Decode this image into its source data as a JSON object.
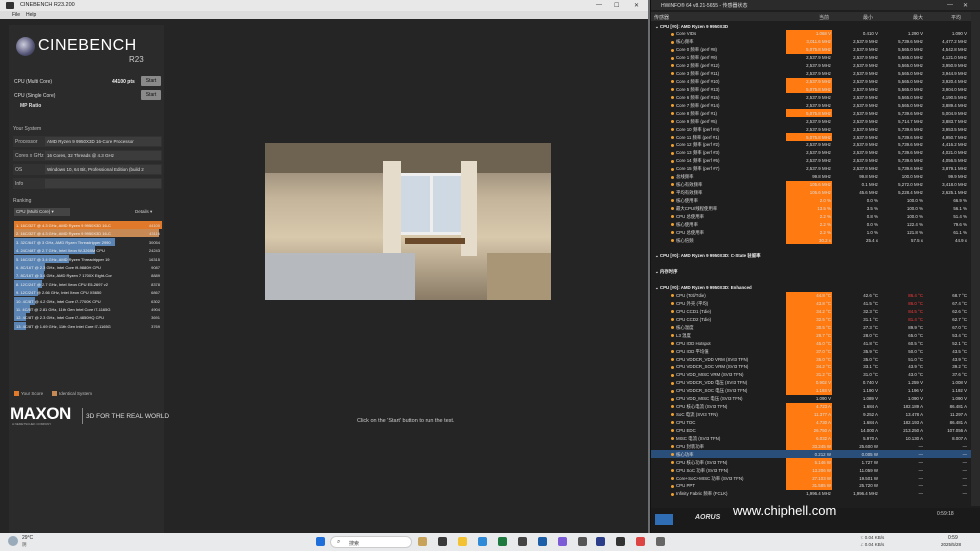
{
  "cinebench": {
    "title": "CINEBENCH R23.200",
    "menu": [
      "File",
      "Help"
    ],
    "logo": "CINEBENCH",
    "logo_sub": "R23",
    "tests": [
      {
        "label": "CPU (Multi Core)",
        "value": "44100 pts",
        "button": "Start"
      },
      {
        "label": "CPU (Single Core)",
        "value": "",
        "button": "Start"
      },
      {
        "label": "MP Ratio",
        "value": "",
        "button": ""
      }
    ],
    "system_heading": "Your System",
    "system": [
      {
        "key": "Processor",
        "value": "AMD Ryzen 9 9950X3D 16-Core Processor"
      },
      {
        "key": "Cores x GHz",
        "value": "16 Cores, 32 Threads @ 4.3 GHz"
      },
      {
        "key": "OS",
        "value": "Windows 10, 64 Bit, Professional Edition (build 2"
      },
      {
        "key": "Info",
        "value": ""
      }
    ],
    "ranking_heading": "Ranking",
    "ranking_dropdown": "CPU (Multi Core)",
    "details_label": "Details",
    "ranking": [
      {
        "label": "1. 16C/32T @ 4.3 GHz, AMD Ryzen 9 9950X3D 16-C",
        "score": "44100",
        "pct": 1.0,
        "color": "#e07a2a"
      },
      {
        "label": "2. 16C/32T @ 4.3 GHz, AMD Ryzen 9 9950X3D 16-C",
        "score": "43116",
        "pct": 0.98,
        "color": "#c88a55"
      },
      {
        "label": "3. 32C/64T @ 3 GHz, AMD Ryzen Threadripper 2990",
        "score": "30054",
        "pct": 0.68,
        "color": "#5a84b4"
      },
      {
        "label": "4. 24C/48T @ 2.7 GHz, Intel Xeon W-3265M CPU",
        "score": "24243",
        "pct": 0.55,
        "color": "#5a84b4"
      },
      {
        "label": "5. 16C/32T @ 3.4 GHz, AMD Ryzen Threadripper 19",
        "score": "16315",
        "pct": 0.37,
        "color": "#5a84b4"
      },
      {
        "label": "6. 8C/16T @ 2.3 GHz, Intel Core i9-9880H CPU",
        "score": "9087",
        "pct": 0.21,
        "color": "#5a84b4"
      },
      {
        "label": "7. 8C/16T @ 3.4 GHz, AMD Ryzen 7 1700X Eight-Cor",
        "score": "8889",
        "pct": 0.2,
        "color": "#5a84b4"
      },
      {
        "label": "8. 12C/24T @ 2.7 GHz, Intel Xeon CPU E5-2697 v2",
        "score": "8378",
        "pct": 0.19,
        "color": "#5a84b4"
      },
      {
        "label": "9. 12C/24T @ 2.66 GHz, Intel Xeon CPU X5650",
        "score": "6867",
        "pct": 0.16,
        "color": "#5a84b4"
      },
      {
        "label": "10. 4C/8T @ 4.2 GHz, Intel Core i7-7700K CPU",
        "score": "6302",
        "pct": 0.14,
        "color": "#5a84b4"
      },
      {
        "label": "11. 4C/8T @ 2.81 GHz, 11th Gen Intel Core i7-1165G",
        "score": "4904",
        "pct": 0.11,
        "color": "#5a84b4"
      },
      {
        "label": "12. 4C/8T @ 2.3 GHz, Intel Core i7-4850HQ CPU",
        "score": "3691",
        "pct": 0.08,
        "color": "#5a84b4"
      },
      {
        "label": "13. 4C/8T @ 1.69 GHz, 11th Gen Intel Core i7-1165G",
        "score": "3769",
        "pct": 0.08,
        "color": "#5a84b4"
      }
    ],
    "legend_your": "Your Score",
    "legend_identical": "Identical System",
    "brand": "MAXON",
    "brand_sub": "A NEMETSCHEK COMPANY",
    "tagline": "3D FOR THE REAL WORLD",
    "status_message": "Click on the 'Start' button to run the test."
  },
  "hwinfo": {
    "title": "HWiNFO® 64 v8.21-5655 - 传感器状态",
    "columns": [
      "传感器",
      "当前",
      "最小",
      "最大",
      "平均"
    ],
    "rows": [
      {
        "name": "CPU [#0]: AMD Ryzen 9 9950X3D",
        "group": true
      },
      {
        "name": "Core VIDs",
        "cur": "1.068 V",
        "min": "0.410 V",
        "max": "1.290 V",
        "avg": "1.090 V",
        "hl": true
      },
      {
        "name": "核心频率",
        "cur": "3,011.6 MHz",
        "min": "2,537.9 MHz",
        "max": "5,739.6 MHz",
        "avg": "4,477.2 MHz",
        "hl": true
      },
      {
        "name": "Core 0 频率 (perf #8)",
        "cur": "5,075.8 MHz",
        "min": "2,537.9 MHz",
        "max": "5,565.0 MHz",
        "avg": "4,542.8 MHz",
        "hl": true
      },
      {
        "name": "Core 1 频率 (perf #9)",
        "cur": "2,537.9 MHz",
        "min": "2,537.9 MHz",
        "max": "5,565.0 MHz",
        "avg": "4,121.0 MHz"
      },
      {
        "name": "Core 2 频率 (perf #12)",
        "cur": "2,537.9 MHz",
        "min": "2,537.9 MHz",
        "max": "5,565.0 MHz",
        "avg": "3,950.9 MHz"
      },
      {
        "name": "Core 3 频率 (perf #11)",
        "cur": "2,537.9 MHz",
        "min": "2,537.9 MHz",
        "max": "5,565.0 MHz",
        "avg": "3,944.9 MHz"
      },
      {
        "name": "Core 4 频率 (perf #10)",
        "cur": "2,537.9 MHz",
        "min": "2,537.9 MHz",
        "max": "5,565.0 MHz",
        "avg": "3,920.4 MHz",
        "hl": true
      },
      {
        "name": "Core 5 频率 (perf #13)",
        "cur": "5,075.8 MHz",
        "min": "2,537.9 MHz",
        "max": "5,565.0 MHz",
        "avg": "3,904.0 MHz",
        "hl": true
      },
      {
        "name": "Core 6 频率 (perf #15)",
        "cur": "2,537.9 MHz",
        "min": "2,537.9 MHz",
        "max": "5,565.0 MHz",
        "avg": "4,190.5 MHz"
      },
      {
        "name": "Core 7 频率 (perf #14)",
        "cur": "2,537.9 MHz",
        "min": "2,537.9 MHz",
        "max": "5,565.0 MHz",
        "avg": "3,889.4 MHz"
      },
      {
        "name": "Core 8 频率 (perf #1)",
        "cur": "5,075.8 MHz",
        "min": "2,537.9 MHz",
        "max": "5,739.6 MHz",
        "avg": "5,004.9 MHz",
        "hl": true
      },
      {
        "name": "Core 9 频率 (perf #5)",
        "cur": "2,537.9 MHz",
        "min": "2,537.9 MHz",
        "max": "5,714.7 MHz",
        "avg": "3,883.7 MHz"
      },
      {
        "name": "Core 10 频率 (perf #4)",
        "cur": "2,537.9 MHz",
        "min": "2,537.9 MHz",
        "max": "5,739.6 MHz",
        "avg": "3,953.5 MHz"
      },
      {
        "name": "Core 11 频率 (perf #1)",
        "cur": "5,075.8 MHz",
        "min": "2,537.9 MHz",
        "max": "5,739.6 MHz",
        "avg": "4,950.7 MHz",
        "hl": true
      },
      {
        "name": "Core 12 频率 (perf #2)",
        "cur": "2,537.9 MHz",
        "min": "2,537.9 MHz",
        "max": "5,739.6 MHz",
        "avg": "4,416.2 MHz"
      },
      {
        "name": "Core 13 频率 (perf #3)",
        "cur": "2,537.9 MHz",
        "min": "2,537.9 MHz",
        "max": "5,739.6 MHz",
        "avg": "4,021.0 MHz"
      },
      {
        "name": "Core 14 频率 (perf #6)",
        "cur": "2,537.9 MHz",
        "min": "2,537.9 MHz",
        "max": "5,739.6 MHz",
        "avg": "4,056.5 MHz"
      },
      {
        "name": "Core 15 频率 (perf #7)",
        "cur": "2,537.9 MHz",
        "min": "2,537.9 MHz",
        "max": "5,739.6 MHz",
        "avg": "3,879.1 MHz"
      },
      {
        "name": "总线频率",
        "cur": "99.8 MHz",
        "min": "99.8 MHz",
        "max": "100.0 MHz",
        "avg": "99.9 MHz"
      },
      {
        "name": "核心有效频率",
        "cur": "105.6 MHz",
        "min": "0.1 MHz",
        "max": "5,272.0 MHz",
        "avg": "3,418.0 MHz",
        "hl": true
      },
      {
        "name": "平均有效频率",
        "cur": "105.6 MHz",
        "min": "45.6 MHz",
        "max": "5,228.4 MHz",
        "avg": "2,625.1 MHz",
        "hl": true
      },
      {
        "name": "核心使用率",
        "cur": "2.0 %",
        "min": "0.0 %",
        "max": "100.0 %",
        "avg": "66.9 %",
        "hl": true
      },
      {
        "name": "最大CPU/线程使用率",
        "cur": "13.5 %",
        "min": "3.5 %",
        "max": "100.0 %",
        "avg": "56.1 %",
        "hl": true
      },
      {
        "name": "CPU 总使用率",
        "cur": "2.2 %",
        "min": "0.8 %",
        "max": "100.0 %",
        "avg": "51.4 %",
        "hl": true
      },
      {
        "name": "核心使用率",
        "cur": "2.2 %",
        "min": "0.0 %",
        "max": "122.4 %",
        "avg": "79.6 %",
        "hl": true
      },
      {
        "name": "CPU 总使用率",
        "cur": "2.2 %",
        "min": "1.0 %",
        "max": "121.8 %",
        "avg": "61.1 %",
        "hl": true
      },
      {
        "name": "核心倍频",
        "cur": "30.2 x",
        "min": "25.4 x",
        "max": "57.5 x",
        "avg": "44.9 x",
        "hl": true
      },
      {
        "name": "",
        "spacer": true
      },
      {
        "name": "CPU [#0]: AMD Ryzen 9 9950X3D: C-State 驻留率",
        "group": true
      },
      {
        "name": "",
        "spacer": true
      },
      {
        "name": "内存时序",
        "group": true
      },
      {
        "name": "",
        "spacer": true
      },
      {
        "name": "CPU [#0]: AMD Ryzen 9 9950X3D: Enhanced",
        "group": true
      },
      {
        "name": "CPU (Tctl/Tdie)",
        "cur": "44.8 °C",
        "min": "42.6 °C",
        "max": "86.4 °C",
        "avg": "68.7 °C",
        "hl": true,
        "redmax": true
      },
      {
        "name": "CPU 外壳 (平均)",
        "cur": "43.8 °C",
        "min": "41.5 °C",
        "max": "86.0 °C",
        "avg": "67.4 °C",
        "hl": true,
        "redmax": true
      },
      {
        "name": "CPU CCD1 (Tdie)",
        "cur": "34.2 °C",
        "min": "32.3 °C",
        "max": "84.5 °C",
        "avg": "62.6 °C",
        "hl": true,
        "redmax": true
      },
      {
        "name": "CPU CCD2 (Tdie)",
        "cur": "32.5 °C",
        "min": "31.1 °C",
        "max": "81.4 °C",
        "avg": "62.7 °C",
        "hl": true,
        "redmax": true
      },
      {
        "name": "核心温度",
        "cur": "30.5 °C",
        "min": "27.3 °C",
        "max": "89.9 °C",
        "avg": "67.0 °C",
        "hl": true
      },
      {
        "name": "L3 温度",
        "cur": "29.7 °C",
        "min": "28.0 °C",
        "max": "65.0 °C",
        "avg": "53.4 °C",
        "hl": true
      },
      {
        "name": "CPU IOD Hotspot",
        "cur": "45.0 °C",
        "min": "41.8 °C",
        "max": "60.5 °C",
        "avg": "52.1 °C",
        "hl": true
      },
      {
        "name": "CPU IOD 平均值",
        "cur": "37.0 °C",
        "min": "35.9 °C",
        "max": "50.0 °C",
        "avg": "43.5 °C",
        "hl": true
      },
      {
        "name": "CPU VDDCR_VDD VRM (SVI3 TFN)",
        "cur": "35.0 °C",
        "min": "35.0 °C",
        "max": "51.0 °C",
        "avg": "43.9 °C",
        "hl": true
      },
      {
        "name": "CPU VDDCR_SOC VRM (SVI3 TFN)",
        "cur": "34.2 °C",
        "min": "33.1 °C",
        "max": "43.9 °C",
        "avg": "39.2 °C",
        "hl": true
      },
      {
        "name": "CPU VDD_MISC VRM (SVI3 TFN)",
        "cur": "31.2 °C",
        "min": "31.0 °C",
        "max": "43.0 °C",
        "avg": "37.6 °C",
        "hl": true
      },
      {
        "name": "CPU VDDCR_VDD 电压 (SVI3 TFN)",
        "cur": "0.902 V",
        "min": "0.740 V",
        "max": "1.259 V",
        "avg": "1.008 V",
        "hl": true
      },
      {
        "name": "CPU VDDCR_SOC 电压 (SVI3 TFN)",
        "cur": "1.193 V",
        "min": "1.190 V",
        "max": "1.196 V",
        "avg": "1.192 V",
        "hl": true
      },
      {
        "name": "CPU VDD_MISC 电压 (SVI3 TFN)",
        "cur": "1.090 V",
        "min": "1.089 V",
        "max": "1.090 V",
        "avg": "1.090 V"
      },
      {
        "name": "CPU 核心电流 (SVI3 TFN)",
        "cur": "4.723 A",
        "min": "1.684 A",
        "max": "182.189 A",
        "avg": "86.481 A",
        "hl": true
      },
      {
        "name": "SoC 电流 (SVI3 TFN)",
        "cur": "11.377 A",
        "min": "9.252 A",
        "max": "13.478 A",
        "avg": "11.297 A",
        "hl": true
      },
      {
        "name": "CPU TDC",
        "cur": "4.730 A",
        "min": "1.684 A",
        "max": "182.193 A",
        "avg": "86.481 A",
        "hl": true
      },
      {
        "name": "CPU EDC",
        "cur": "26.750 A",
        "min": "14.000 A",
        "max": "213.250 A",
        "avg": "107.056 A",
        "hl": true
      },
      {
        "name": "MISC 电流 (SVI3 TFN)",
        "cur": "6.032 A",
        "min": "5.970 A",
        "max": "10.130 A",
        "avg": "8.007 A",
        "hl": true
      },
      {
        "name": "CPU 封装功率",
        "cur": "33.245 W",
        "min": "25.600 W",
        "max": "—",
        "avg": "—",
        "hl": true
      },
      {
        "name": "核心功率",
        "cur": "0.212 W",
        "min": "0.005 W",
        "max": "—",
        "avg": "—",
        "sel": true
      },
      {
        "name": "CPU 核心功率 (SVI3 TFN)",
        "cur": "5.146 W",
        "min": "1.727 W",
        "max": "—",
        "avg": "—",
        "hl": true
      },
      {
        "name": "CPU SoC 功率 (SVI3 TFN)",
        "cur": "13.206 W",
        "min": "11.059 W",
        "max": "—",
        "avg": "—",
        "hl": true
      },
      {
        "name": "Core+SoC+MISC 功率 (SVI3 TFN)",
        "cur": "27.103 W",
        "min": "19.501 W",
        "max": "—",
        "avg": "—",
        "hl": true
      },
      {
        "name": "CPU PPT",
        "cur": "31.585 W",
        "min": "25.720 W",
        "max": "—",
        "avg": "—",
        "hl": true
      },
      {
        "name": "Infinity Fabric 频率 (FCLK)",
        "cur": "1,996.4 MHz",
        "min": "1,996.4 MHz",
        "max": "—",
        "avg": "—"
      }
    ],
    "bottom_brand": "AORUS",
    "watermark": "www.chiphell.com",
    "clock": "0:59:18",
    "net": "0.04 KB/s"
  },
  "taskbar": {
    "weather": "29°C",
    "weather_sub": "阴",
    "search_placeholder": "搜索",
    "tray_up": "↑: 0.04 KB/s",
    "tray_down": "↓: 0.04 KB/s",
    "time": "0:59",
    "date": "2025/5/28"
  }
}
